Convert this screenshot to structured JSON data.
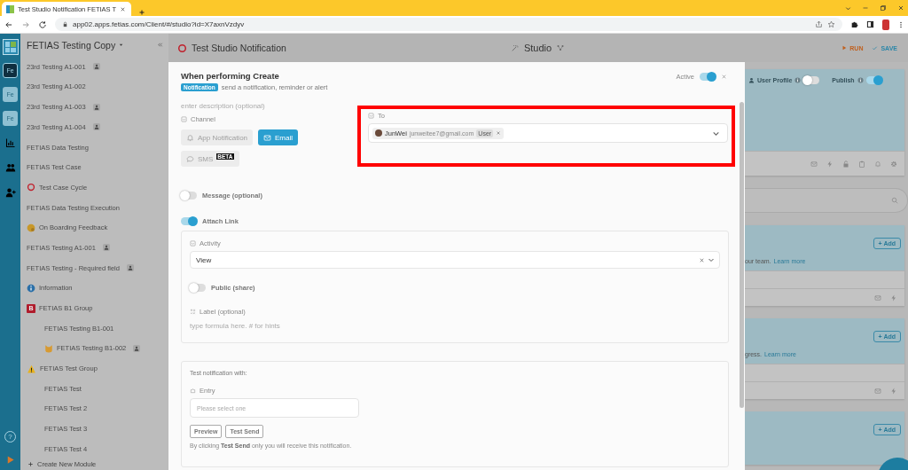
{
  "browser": {
    "tab_title": "Test Studio Notification FETIAS T",
    "url": "app02.apps.fetias.com/Client/#/studio?id=X7axnVzdyv"
  },
  "rail": {
    "apps": [
      {
        "label": "Fe",
        "selected": true
      },
      {
        "label": "Fe",
        "selected": false
      },
      {
        "label": "Fe",
        "selected": false
      }
    ],
    "help": "?"
  },
  "sidebar": {
    "title": "FETIAS Testing Copy",
    "items": [
      {
        "label": "23rd Testing A1-001",
        "kind": "plain",
        "shared": true
      },
      {
        "label": "23rd Testing A1-002",
        "kind": "plain",
        "shared": false
      },
      {
        "label": "23rd Testing A1-003",
        "kind": "plain",
        "shared": true
      },
      {
        "label": "23rd Testing A1-004",
        "kind": "plain",
        "shared": true
      },
      {
        "label": "FETIAS Data Testing",
        "kind": "plain",
        "shared": false
      },
      {
        "label": "FETIAS Test Case",
        "kind": "plain",
        "shared": false
      },
      {
        "label": "Test Case Cycle",
        "kind": "ring",
        "shared": false
      },
      {
        "label": "FETIAS Data Testing Execution",
        "kind": "plain",
        "shared": false
      },
      {
        "label": "On Boarding Feedback",
        "kind": "emoji",
        "shared": false
      },
      {
        "label": "FETIAS Testing A1-001",
        "kind": "plain",
        "shared": true
      },
      {
        "label": "FETIAS Testing - Required field",
        "kind": "plain",
        "shared": true
      },
      {
        "label": "Information",
        "kind": "info",
        "shared": false
      },
      {
        "label": "FETIAS B1 Group",
        "kind": "letter",
        "badge": "B",
        "shared": false,
        "children": [
          {
            "label": "FETIAS Testing B1-001",
            "kind": "plain",
            "shared": false
          },
          {
            "label": "FETIAS Testing B1-002",
            "kind": "cat",
            "shared": true
          }
        ]
      },
      {
        "label": "FETIAS Test Group",
        "kind": "warning",
        "shared": false,
        "children": [
          {
            "label": "FETIAS Test",
            "kind": "plain",
            "shared": false
          },
          {
            "label": "FETIAS Test 2",
            "kind": "plain",
            "shared": false
          },
          {
            "label": "FETIAS Test 3",
            "kind": "plain",
            "shared": false
          },
          {
            "label": "FETIAS Test 4",
            "kind": "plain",
            "shared": false
          }
        ]
      }
    ],
    "create": "Create New Module"
  },
  "header": {
    "title": "Test Studio Notification",
    "center": "Studio",
    "run": "RUN",
    "save": "SAVE"
  },
  "modal": {
    "title": "When performing Create",
    "badge": "Notification",
    "subtitle": "send a notification, reminder or alert",
    "active": {
      "label": "Active",
      "on": true
    },
    "description": {
      "placeholder": "enter description (optional)"
    },
    "channel": {
      "label": "Channel",
      "options": [
        {
          "label": "App Notification",
          "kind": "bell",
          "selected": false
        },
        {
          "label": "Email",
          "kind": "mail",
          "selected": true
        },
        {
          "label": "SMS",
          "kind": "chat",
          "selected": false,
          "tag": "BETA"
        }
      ]
    },
    "to": {
      "label": "To",
      "highlighted": true,
      "recipients": [
        {
          "name": "JunWei",
          "email": "junweitee7@gmail.com",
          "type": "User"
        }
      ]
    },
    "message": {
      "label": "Message (optional)",
      "on": false
    },
    "attach_link": {
      "label": "Attach Link",
      "on": true
    },
    "activity": {
      "label": "Activity",
      "value": "View"
    },
    "public": {
      "label": "Public (share)",
      "on": false
    },
    "link_label": {
      "label": "Label (optional)",
      "placeholder": "type formula here. # for hints"
    },
    "test": {
      "heading": "Test notification with:",
      "entry_label": "Entry",
      "entry_placeholder": "Please select one",
      "buttons": [
        "Preview",
        "Test Send"
      ],
      "note": "By clicking **Test Send** only you will receive this notification."
    }
  },
  "background": {
    "toggles": [
      {
        "label": "User Profile",
        "on": false
      },
      {
        "label": "Publish",
        "on": true
      }
    ],
    "cards": [
      {
        "text": "our team.",
        "link": "Learn more",
        "add": "+ Add"
      },
      {
        "text": "gress.",
        "link": "Learn more",
        "add": "+ Add"
      },
      {
        "add": "+ Add"
      }
    ]
  }
}
